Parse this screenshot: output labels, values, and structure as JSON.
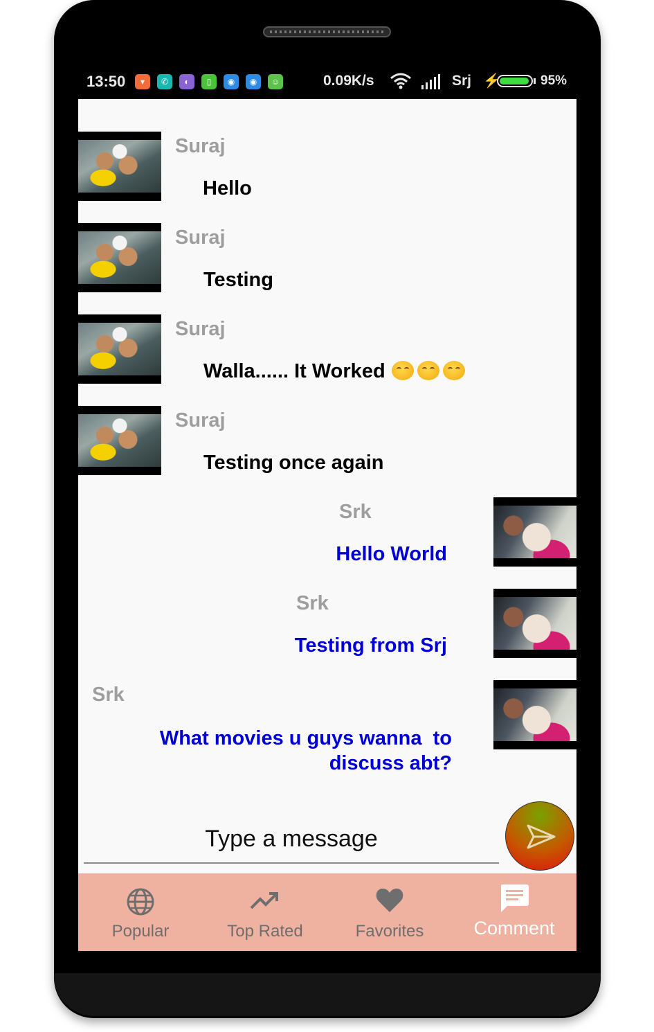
{
  "status_bar": {
    "time": "13:50",
    "net_speed": "0.09K/s",
    "carrier": "Srj",
    "battery_percent": "95%",
    "battery_level": 0.95,
    "notification_icons": [
      "mi-store-icon",
      "chat-app-icon",
      "purple-app-icon",
      "green-app-icon",
      "messenger-icon",
      "messenger-icon",
      "android-icon"
    ]
  },
  "messages": [
    {
      "sender": "Suraj",
      "text": "Hello",
      "mine": false
    },
    {
      "sender": "Suraj",
      "text": "Testing",
      "mine": false
    },
    {
      "sender": "Suraj",
      "text": "Walla...... It Worked",
      "emoji_count": 3,
      "mine": false
    },
    {
      "sender": "Suraj",
      "text": "Testing once again",
      "mine": false
    },
    {
      "sender": "Srk",
      "text": "Hello World",
      "mine": true
    },
    {
      "sender": "Srk",
      "text": "Testing from Srj",
      "mine": true
    },
    {
      "sender": "Srk",
      "text": "What movies u guys wanna  to discuss abt?",
      "mine": true
    }
  ],
  "composer": {
    "placeholder": "Type a message"
  },
  "bottom_nav": [
    {
      "label": "Popular",
      "icon": "globe-icon",
      "active": false
    },
    {
      "label": "Top Rated",
      "icon": "trending-up-icon",
      "active": false
    },
    {
      "label": "Favorites",
      "icon": "heart-icon",
      "active": false
    },
    {
      "label": "Comment",
      "icon": "comment-icon",
      "active": true
    }
  ],
  "colors": {
    "accent_nav": "#f0b2a0",
    "mine_text": "#0000d4",
    "sender_text": "#9e9e9e"
  }
}
